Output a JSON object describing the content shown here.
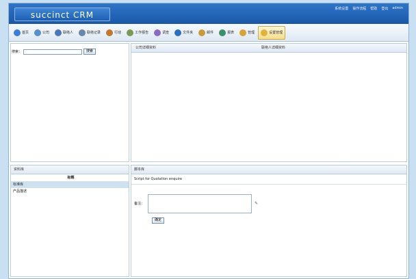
{
  "app": {
    "logo": "succinct CRM"
  },
  "top_links": [
    "系统设置",
    "操作流程",
    "帮助",
    "登出",
    "admin"
  ],
  "toolbar": [
    {
      "label": "首页",
      "icon": "globe-icon",
      "color": "#3b7dd8"
    },
    {
      "label": "公司",
      "icon": "building-icon",
      "color": "#5a8fcf"
    },
    {
      "label": "联络人",
      "icon": "contacts-icon",
      "color": "#4c77b8"
    },
    {
      "label": "联络记录",
      "icon": "calendar-icon",
      "color": "#6b87a8"
    },
    {
      "label": "行动",
      "icon": "person-icon",
      "color": "#c07a2c"
    },
    {
      "label": "工作报告",
      "icon": "report-icon",
      "color": "#7a9a55"
    },
    {
      "label": "调查",
      "icon": "survey-icon",
      "color": "#8a6bbf"
    },
    {
      "label": "文件夹",
      "icon": "folder-icon",
      "color": "#2d6fbf"
    },
    {
      "label": "邮件",
      "icon": "mail-icon",
      "color": "#c99b3a"
    },
    {
      "label": "报表",
      "icon": "chart-icon",
      "color": "#3c8f6a"
    },
    {
      "label": "管理",
      "icon": "admin-icon",
      "color": "#d7a436"
    },
    {
      "label": "设置管理",
      "icon": "settings-icon",
      "color": "#e3b23c",
      "active": true
    }
  ],
  "search": {
    "label": "搜索：",
    "button": "搜索"
  },
  "right_top": {
    "col1": "公司详细资料",
    "col2": "联络人详细资料"
  },
  "left_bottom": {
    "title": "资料库",
    "subtitle": "标题",
    "items": [
      "标准库",
      "产品描述"
    ]
  },
  "right_bottom": {
    "title": "脚本库",
    "script_name": "Script for Quotation enquire",
    "note_label": "备注：",
    "confirm": "确定"
  }
}
